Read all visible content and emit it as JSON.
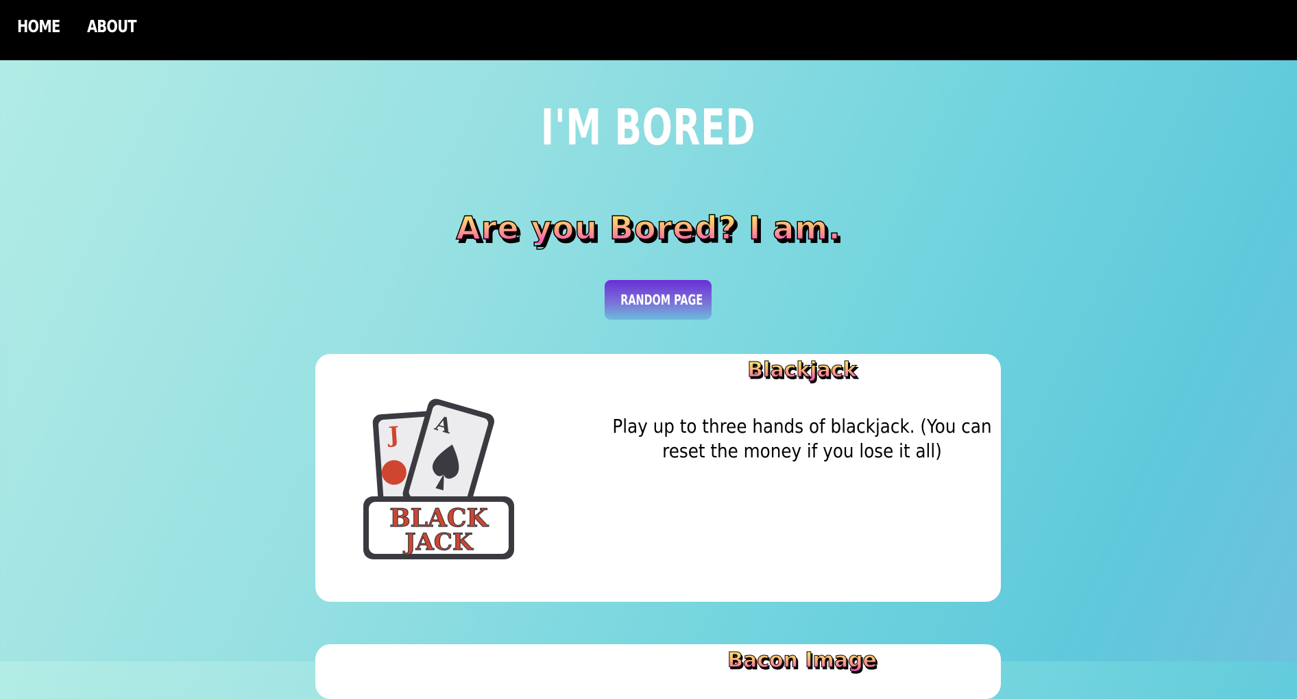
{
  "nav": {
    "home_label": "HOME",
    "about_label": "ABOUT"
  },
  "header": {
    "title": "I'M BORED",
    "tagline": "Are you Bored? I am."
  },
  "random_button_label": "RANDOM PAGE",
  "cards": [
    {
      "title": "Blackjack",
      "description": "Play up to three hands of blackjack. (You can reset the money if you lose it all)",
      "image": {
        "card_back_rank": "J",
        "card_front_rank": "A",
        "logo_line1": "BLACK",
        "logo_line2": "JACK"
      }
    },
    {
      "title": "Bacon Image"
    }
  ],
  "colors": {
    "nav_bg": "#000000",
    "button_top": "#6a2fd6",
    "button_bottom": "#6cbcdc",
    "heading_gradient_top": "#ffef66",
    "heading_gradient_bottom": "#ff54b8",
    "logo_red": "#d0452f",
    "logo_dark": "#3a3a40"
  }
}
